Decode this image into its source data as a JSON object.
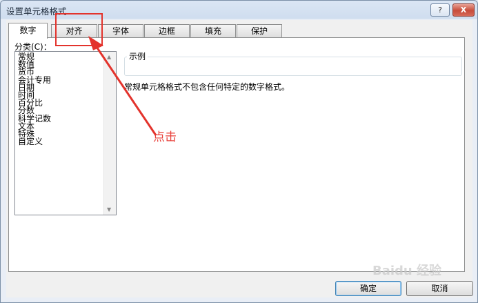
{
  "window": {
    "title": "设置单元格格式",
    "help_label": "?",
    "close_label": "X"
  },
  "tabs": [
    {
      "label": "数字",
      "active": true
    },
    {
      "label": "对齐",
      "active": false
    },
    {
      "label": "字体",
      "active": false
    },
    {
      "label": "边框",
      "active": false
    },
    {
      "label": "填充",
      "active": false
    },
    {
      "label": "保护",
      "active": false
    }
  ],
  "category": {
    "label": "分类(C)：",
    "items": [
      "常规",
      "数值",
      "货币",
      "会计专用",
      "日期",
      "时间",
      "百分比",
      "分数",
      "科学记数",
      "文本",
      "特殊",
      "自定义"
    ],
    "selected": "常规"
  },
  "sample": {
    "label": "示例",
    "value": ""
  },
  "description": "常规单元格格式不包含任何特定的数字格式。",
  "annotation": {
    "text": "点击",
    "color": "#e8403a"
  },
  "buttons": {
    "ok": "确定",
    "cancel": "取消"
  },
  "watermark": "Baidu 经验"
}
